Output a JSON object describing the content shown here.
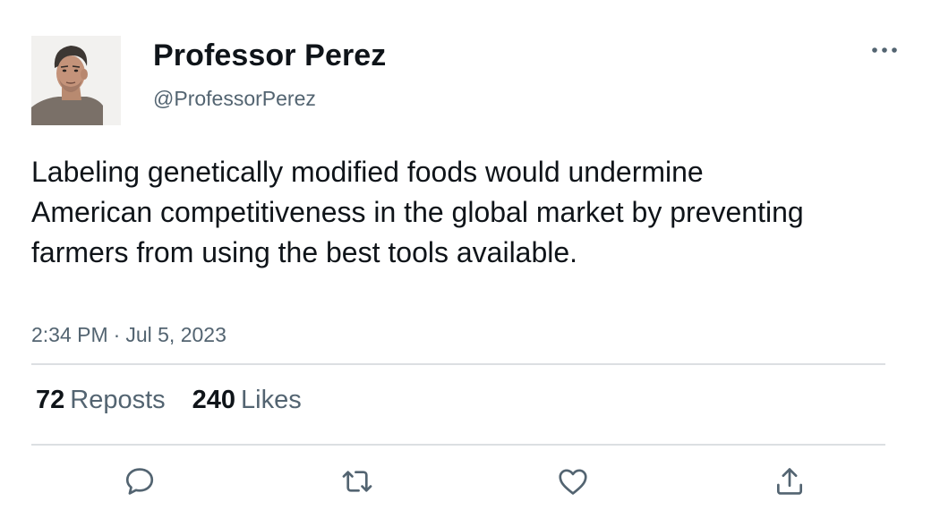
{
  "author": {
    "display_name": "Professor Perez",
    "handle": "@ProfessorPerez",
    "avatar": "profile-photo"
  },
  "tweet": {
    "text": "Labeling genetically modified foods would undermine American competitiveness in the global market by preventing farmers from using the best tools available.",
    "time": "2:34 PM",
    "separator": "·",
    "date": "Jul 5, 2023"
  },
  "stats": {
    "reposts_count": "72",
    "reposts_label": "Reposts",
    "likes_count": "240",
    "likes_label": "Likes"
  },
  "icons": {
    "more": "more-horizontal-icon",
    "reply": "reply-icon",
    "repost": "repost-icon",
    "like": "heart-icon",
    "share": "share-icon"
  },
  "colors": {
    "text_primary": "#0f1419",
    "text_secondary": "#536471",
    "icon": "#536471",
    "divider": "#dcdfe2"
  }
}
